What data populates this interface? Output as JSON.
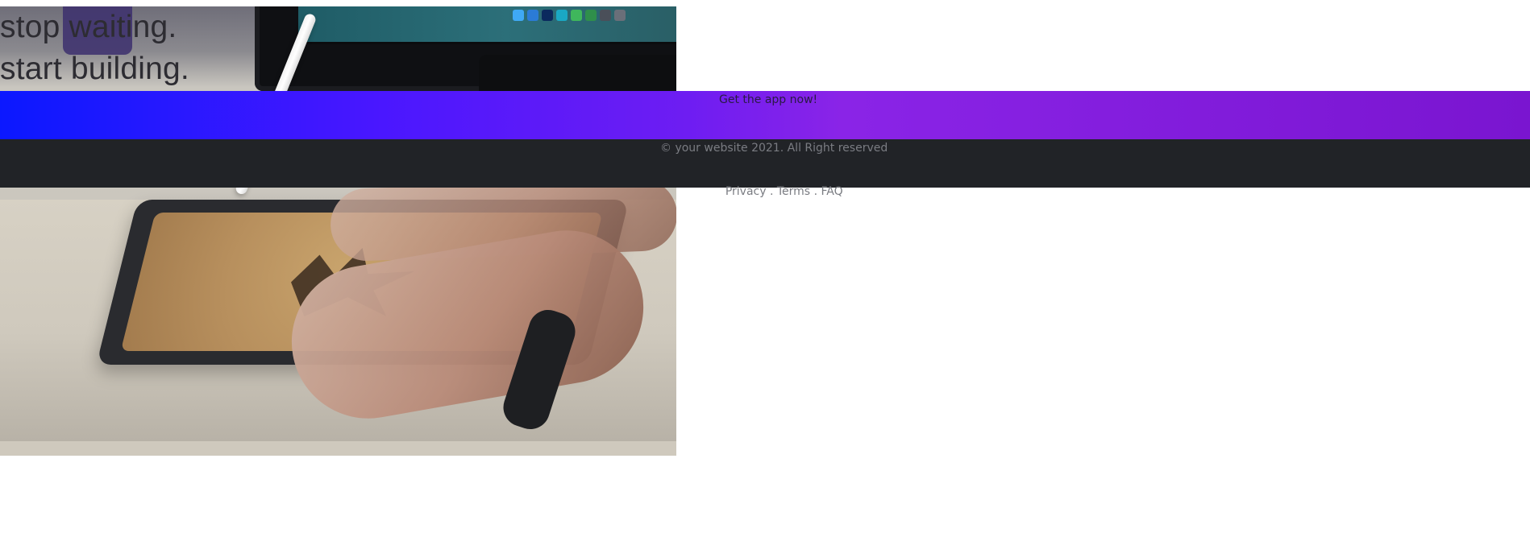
{
  "hero": {
    "title_line_1": "stop waiting.",
    "title_line_2": "start building."
  },
  "cta": {
    "label": "Get the app now!"
  },
  "footer": {
    "copyright": "© your website 2021. All Right reserved",
    "links": [
      {
        "label": "Privacy"
      },
      {
        "label": "Terms"
      },
      {
        "label": "FAQ"
      }
    ],
    "separator": "."
  }
}
